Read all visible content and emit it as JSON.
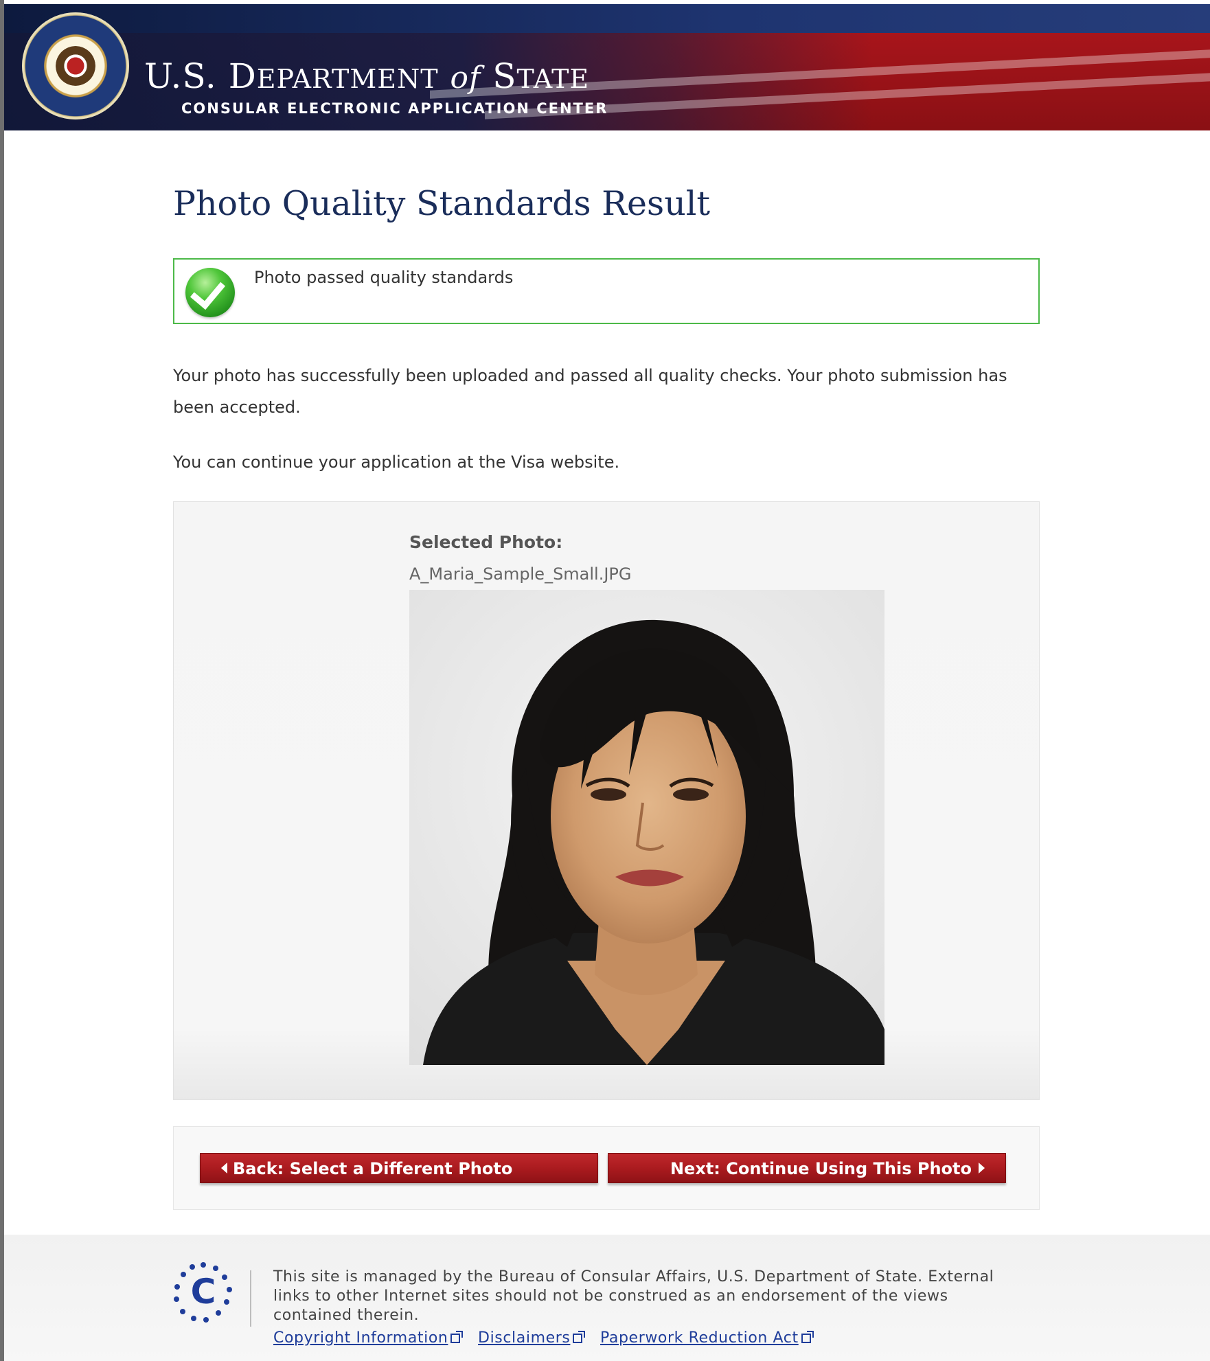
{
  "header": {
    "brand_us": "U.S. D",
    "brand_epartment": "EPARTMENT",
    "brand_of": "of",
    "brand_s": "S",
    "brand_tate": "TATE",
    "subtitle": "CONSULAR ELECTRONIC APPLICATION CENTER"
  },
  "page": {
    "title": "Photo Quality Standards Result"
  },
  "status": {
    "message": "Photo passed quality standards",
    "color": "#4cb948"
  },
  "body": {
    "paragraph1": "Your photo has successfully been uploaded and passed all quality checks. Your photo submission has been accepted.",
    "paragraph2": "You can continue your application at the Visa website."
  },
  "photo": {
    "label": "Selected Photo:",
    "filename": "A_Maria_Sample_Small.JPG"
  },
  "buttons": {
    "back_label": "Back: Select a Different Photo",
    "next_label": "Next: Continue Using This Photo",
    "color": "#a81a1e"
  },
  "footer": {
    "text": "This site is managed by the Bureau of Consular Affairs, U.S. Department of State. External links to other Internet sites should not be construed as an endorsement of the views contained therein.",
    "links": {
      "copyright": "Copyright Information",
      "disclaimers": "Disclaimers",
      "paperwork": "Paperwork Reduction Act"
    },
    "logo_letter": "C"
  }
}
